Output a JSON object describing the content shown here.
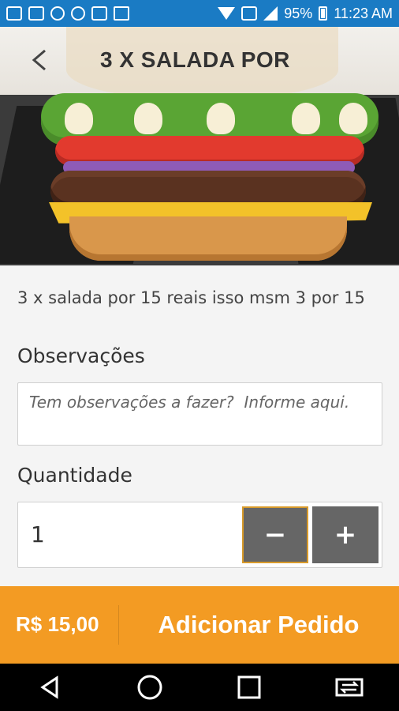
{
  "status_bar": {
    "battery_text": "95%",
    "time": "11:23 AM"
  },
  "header": {
    "title": "3 X SALADA POR",
    "back_icon": "back-icon"
  },
  "product": {
    "image_desc_icon": "burger-image",
    "description": "3 x salada por 15 reais isso msm 3 por 15"
  },
  "observations": {
    "label": "Observações",
    "placeholder": "Tem observações a fazer?  Informe aqui."
  },
  "quantity": {
    "label": "Quantidade",
    "value": "1",
    "minus_label": "−",
    "plus_label": "+"
  },
  "order": {
    "price": "R$ 15,00",
    "add_label": "Adicionar Pedido",
    "color": "#f39b23"
  },
  "colors": {
    "status_bar": "#1a7bc4",
    "button_gray": "#666666",
    "accent_border": "#d89a2a"
  }
}
